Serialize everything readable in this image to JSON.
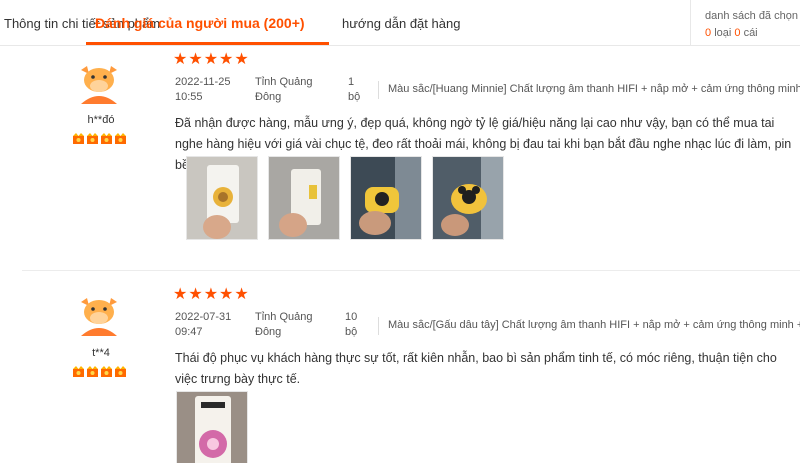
{
  "tabs": {
    "info": "Thông tin chi tiết sản phẩm",
    "reviews": "Đánh giá của người mua (200+)",
    "guide": "hướng dẫn đặt hàng"
  },
  "selection_panel": {
    "title": "danh sách đã chọn",
    "kinds_count": "0",
    "kinds_label": "loại",
    "items_count": "0",
    "items_label": "cái"
  },
  "reviews": [
    {
      "username": "h**đó",
      "rating": 5,
      "date": "2022-11-25 10:55",
      "location": "Tỉnh Quảng Đông",
      "quantity": "1 bộ",
      "variant": "Màu sắc/[Huang Minnie] Chất lượng âm thanh HIFI + nắp mở + cảm ứng thông minh + ...",
      "comment": "Đã nhận được hàng, mẫu ưng ý, đẹp quá, không ngờ tỷ lệ giá/hiệu năng lại cao như vậy, bạn có thể mua tai nghe hàng hiệu với giá vài chục tệ, đeo rất thoải mái, không bị đau tai khi bạn bắt đầu nghe nhạc lúc đi làm, pin bền.",
      "photo_count": 4
    },
    {
      "username": "t**4",
      "rating": 5,
      "date": "2022-07-31 09:47",
      "location": "Tỉnh Quảng Đông",
      "quantity": "10 bộ",
      "variant": "Màu sắc/[Gấu dâu tây] Chất lượng âm thanh HIFI + nắp mở + cảm ứng thông minh + ...",
      "comment": "Thái độ phục vụ khách hàng thực sự tốt, rất kiên nhẫn, bao bì sản phẩm tinh tế, có móc riêng, thuận tiện cho việc trưng bày thực tế.",
      "photo_count": 1
    }
  ],
  "colors": {
    "accent": "#ff5000"
  }
}
